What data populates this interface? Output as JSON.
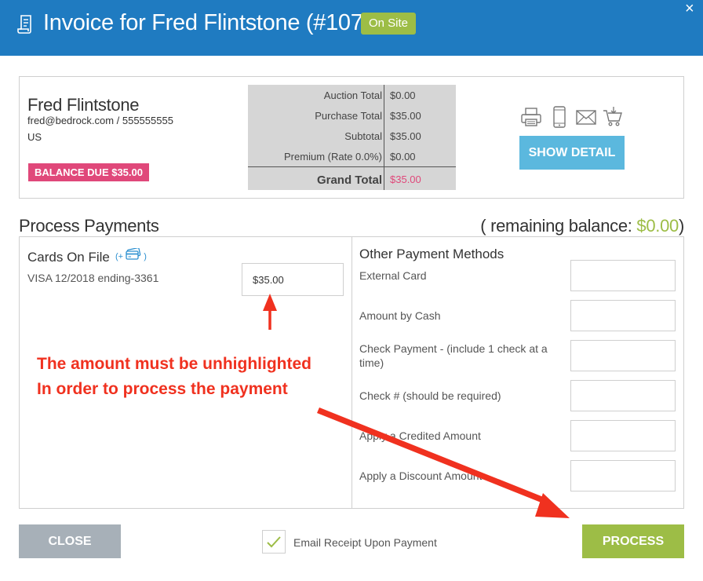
{
  "header": {
    "title": "Invoice for Fred Flintstone (#107)",
    "badge": "On Site",
    "close_symbol": "×",
    "bg_color": "#1f7bc1",
    "icon": "receipt-icon"
  },
  "customer": {
    "name": "Fred Flintstone",
    "contact": "fred@bedrock.com / 555555555",
    "country": "US",
    "balance_badge": "BALANCE DUE $35.00"
  },
  "totals": {
    "rows": [
      {
        "label": "Auction Total",
        "value": "$0.00"
      },
      {
        "label": "Purchase Total",
        "value": "$35.00"
      },
      {
        "label": "Subtotal",
        "value": "$35.00"
      },
      {
        "label": "Premium (Rate 0.0%)",
        "value": "$0.00"
      }
    ],
    "grand": {
      "label": "Grand Total",
      "value": "$35.00"
    }
  },
  "actions": {
    "icons": [
      "printer-icon",
      "mobile-icon",
      "email-icon",
      "cart-icon"
    ],
    "show_detail": "SHOW DETAIL"
  },
  "process": {
    "title": "Process Payments",
    "remaining_prefix": "( remaining balance: ",
    "remaining_amount": "$0.00",
    "remaining_suffix": ")"
  },
  "cards": {
    "title": "Cards On File",
    "add_label": "(+",
    "add_suffix": ")",
    "card_line": "VISA 12/2018 ending-3361",
    "amount": "$35.00"
  },
  "other_methods": {
    "title": "Other Payment Methods",
    "fields": [
      {
        "label": "External Card",
        "value": ""
      },
      {
        "label": "Amount by Cash",
        "value": ""
      },
      {
        "label": "Check Payment - (include 1 check at a time)",
        "value": ""
      },
      {
        "label": "Check # (should be required)",
        "value": ""
      },
      {
        "label": "Apply a Credited Amount",
        "value": ""
      },
      {
        "label": "Apply a Discount Amount",
        "value": ""
      }
    ]
  },
  "annotation": {
    "line1": "The amount must be unhighlighted",
    "line2": "In order to process the payment",
    "color": "#f0311f"
  },
  "footer": {
    "close": "CLOSE",
    "email_receipt": "Email Receipt Upon Payment",
    "email_checked": true,
    "process": "PROCESS"
  },
  "colors": {
    "accent_green": "#9dbd46",
    "accent_pink": "#e0487a",
    "accent_blue": "#5bb8de"
  }
}
